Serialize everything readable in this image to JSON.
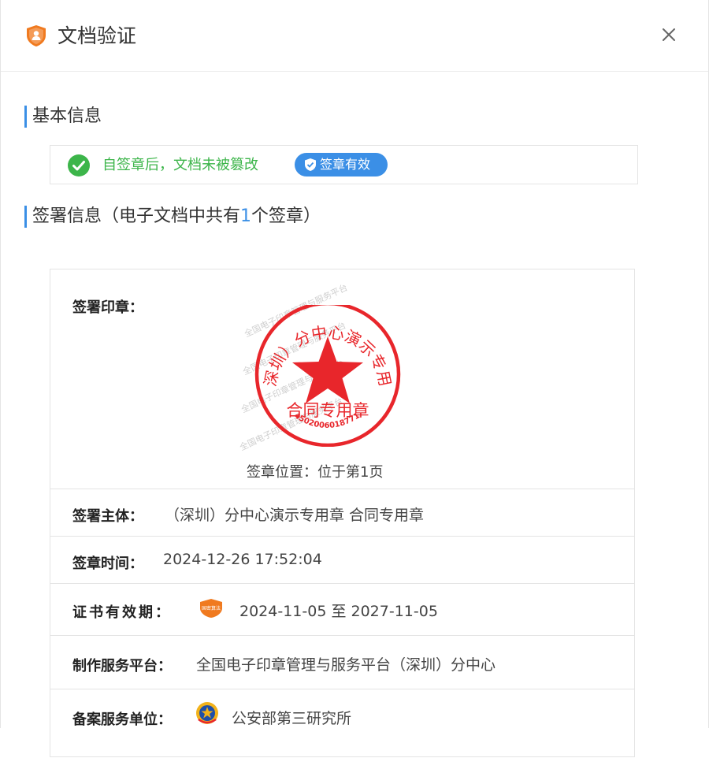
{
  "dialog": {
    "title": "文档验证",
    "icons": {
      "title": "shield-user-icon",
      "close": "close-icon"
    }
  },
  "basic": {
    "heading": "基本信息",
    "status_text": "自签章后，文档未被篡改",
    "badge_label": "签章有效",
    "colors": {
      "ok": "#3cb54a",
      "accent": "#3b8fe6"
    }
  },
  "signing": {
    "heading_prefix": "签署信息（电子文档中共有",
    "count": "1",
    "heading_suffix": "个签章）"
  },
  "seal": {
    "label": "签署印章：",
    "top_text": "（深圳）分中心演示专用章",
    "center_text": "合同专用章",
    "code": "4502006018771",
    "color": "#e8262b",
    "position_text": "签章位置：位于第1页",
    "watermark": "全国电子印章管理与服务平台"
  },
  "fields": {
    "subject_label": "签署主体：",
    "subject_value": "（深圳）分中心演示专用章 合同专用章",
    "time_label": "签章时间：",
    "time_value": "2024-12-26 17:52:04",
    "validity_label": "证书有效期：",
    "validity_badge": "国密算法",
    "validity_value": "2024-11-05 至 2027-11-05",
    "platform_label": "制作服务平台：",
    "platform_value": "全国电子印章管理与服务平台（深圳）分中心",
    "filing_label": "备案服务单位：",
    "filing_value": "公安部第三研究所"
  }
}
